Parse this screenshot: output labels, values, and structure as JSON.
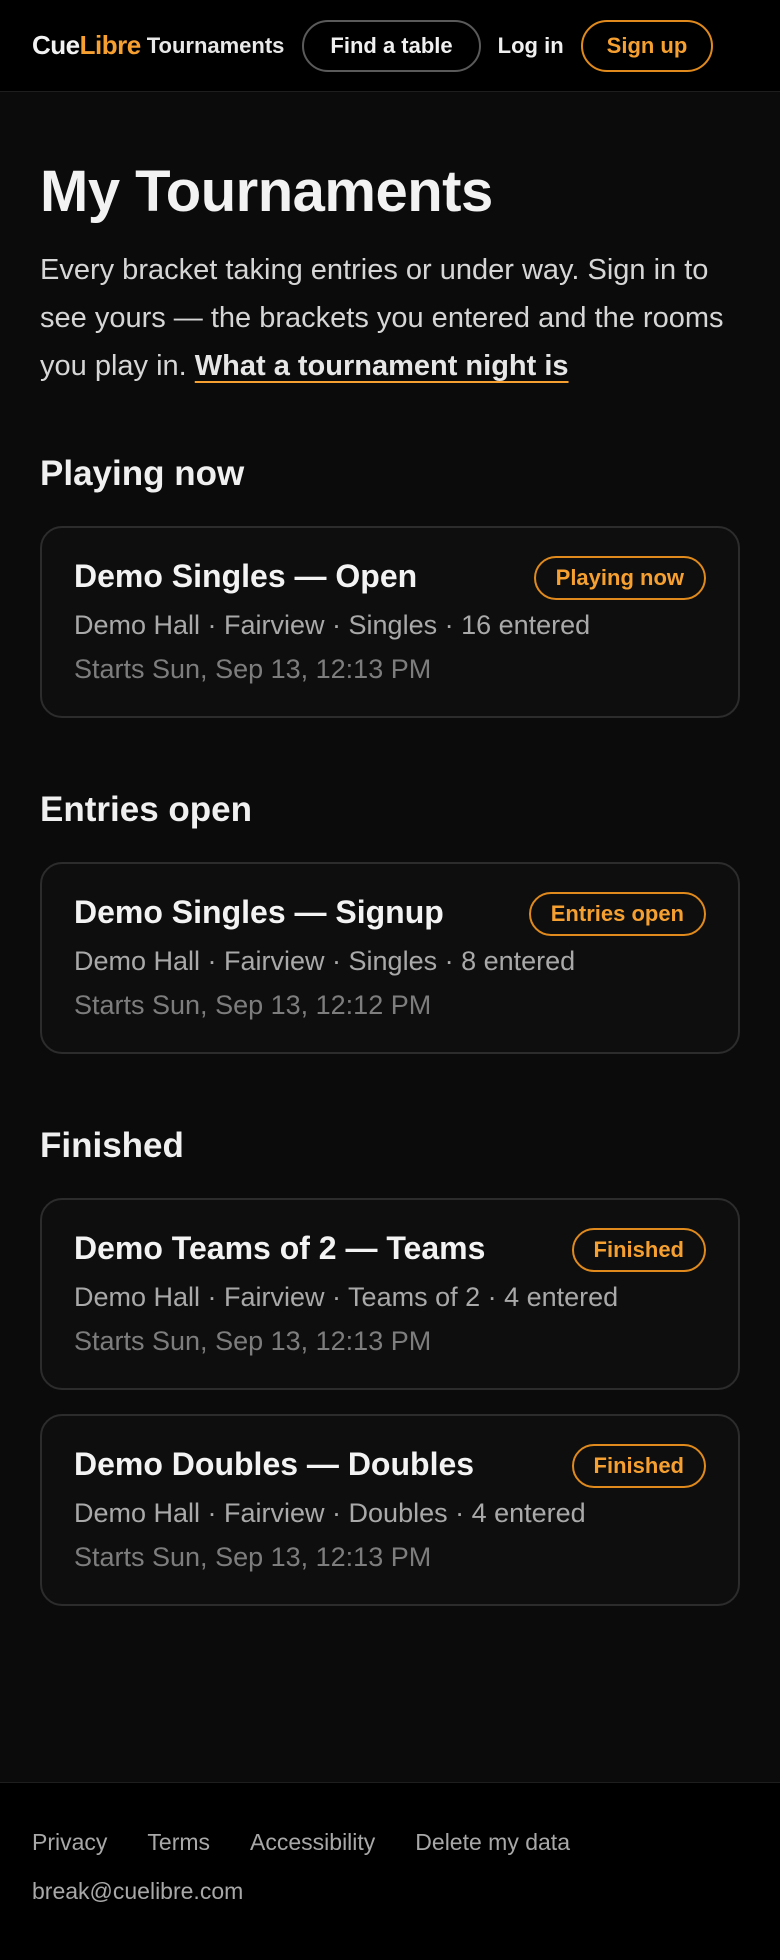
{
  "header": {
    "brand_part1": "Cue",
    "brand_part2": "Libre",
    "tournaments_label": "Tournaments",
    "find_table_label": "Find a table",
    "login_label": "Log in",
    "signup_label": "Sign up"
  },
  "page": {
    "title": "My Tournaments",
    "intro_text": "Every bracket taking entries or under way. Sign in to see yours — the brackets you entered and the rooms you play in. ",
    "intro_link": "What a tournament night is"
  },
  "sections": [
    {
      "heading": "Playing now",
      "cards": [
        {
          "title": "Demo Singles — Open",
          "badge": "Playing now",
          "meta": "Demo Hall · Fairview · Singles · 16 entered",
          "start": "Starts Sun, Sep 13, 12:13 PM"
        }
      ]
    },
    {
      "heading": "Entries open",
      "cards": [
        {
          "title": "Demo Singles — Signup",
          "badge": "Entries open",
          "meta": "Demo Hall · Fairview · Singles · 8 entered",
          "start": "Starts Sun, Sep 13, 12:12 PM"
        }
      ]
    },
    {
      "heading": "Finished",
      "cards": [
        {
          "title": "Demo Teams of 2 — Teams",
          "badge": "Finished",
          "meta": "Demo Hall · Fairview · Teams of 2 · 4 entered",
          "start": "Starts Sun, Sep 13, 12:13 PM"
        },
        {
          "title": "Demo Doubles — Doubles",
          "badge": "Finished",
          "meta": "Demo Hall · Fairview · Doubles · 4 entered",
          "start": "Starts Sun, Sep 13, 12:13 PM"
        }
      ]
    }
  ],
  "footer": {
    "links": [
      "Privacy",
      "Terms",
      "Accessibility",
      "Delete my data"
    ],
    "email": "break@cuelibre.com"
  },
  "colors": {
    "accent": "#f5a031",
    "background": "#0b0b0b",
    "header_background": "#000000"
  }
}
